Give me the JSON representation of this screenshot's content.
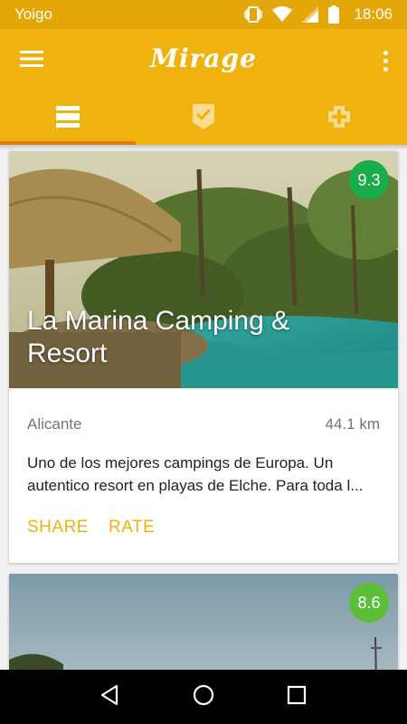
{
  "status_bar": {
    "carrier": "Yoigo",
    "time": "18:06"
  },
  "app_bar": {
    "title": "Mirage"
  },
  "tabs": [
    {
      "icon": "list-view-icon",
      "active": true
    },
    {
      "icon": "checkmark-badge-icon",
      "active": false
    },
    {
      "icon": "add-square-icon",
      "active": false
    }
  ],
  "cards": [
    {
      "title": "La Marina Camping & Resort",
      "rating": "9.3",
      "rating_color": "#1aab4a",
      "location": "Alicante",
      "distance": "44.1 km",
      "description": "Uno de los mejores campings de Europa. Un autentico resort en playas de Elche. Para toda l...",
      "actions": [
        "SHARE",
        "RATE"
      ]
    },
    {
      "rating": "8.6",
      "rating_color": "#5cbf3a"
    }
  ],
  "colors": {
    "status_bar": "#e3a709",
    "app_bar": "#f0b30e",
    "tab_indicator": "#e07d0e",
    "accent": "#f0b30e"
  }
}
